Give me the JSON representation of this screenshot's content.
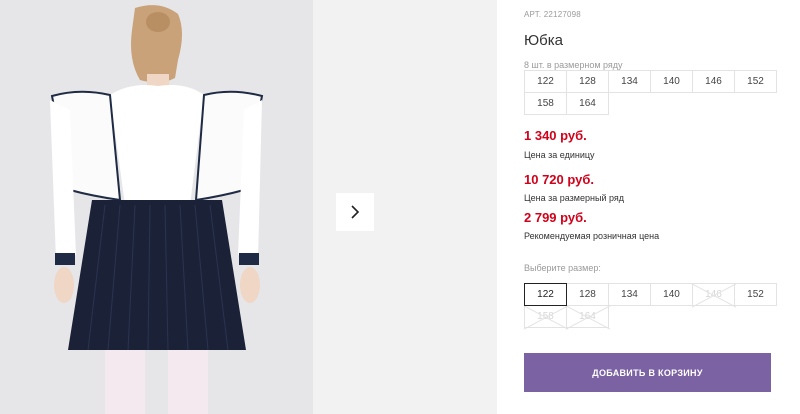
{
  "product": {
    "article": "АРТ. 22127098",
    "title": "Юбка",
    "row_label": "8 шт. в размерном ряду",
    "row_sizes": [
      "122",
      "128",
      "134",
      "140",
      "146",
      "152",
      "158",
      "164"
    ],
    "prices": [
      {
        "value": "1 340 руб.",
        "label": "Цена за единицу"
      },
      {
        "value": "10 720 руб.",
        "label": "Цена за размерный ряд"
      },
      {
        "value": "2 799 руб.",
        "label": "Рекомендуемая розничная цена"
      }
    ],
    "select_label": "Выберите размер:",
    "size_options": [
      {
        "label": "122",
        "state": "selected"
      },
      {
        "label": "128",
        "state": "available"
      },
      {
        "label": "134",
        "state": "available"
      },
      {
        "label": "140",
        "state": "available"
      },
      {
        "label": "146",
        "state": "unavailable"
      },
      {
        "label": "152",
        "state": "available"
      },
      {
        "label": "158",
        "state": "unavailable"
      },
      {
        "label": "164",
        "state": "unavailable"
      }
    ],
    "add_to_cart_label": "ДОБАВИТЬ В КОРЗИНУ"
  },
  "gallery": {
    "next_icon": "chevron-right-icon"
  },
  "colors": {
    "price": "#d0021b",
    "button": "#7b62a3",
    "muted": "#9a9a9a",
    "border": "#e3e3e3"
  }
}
